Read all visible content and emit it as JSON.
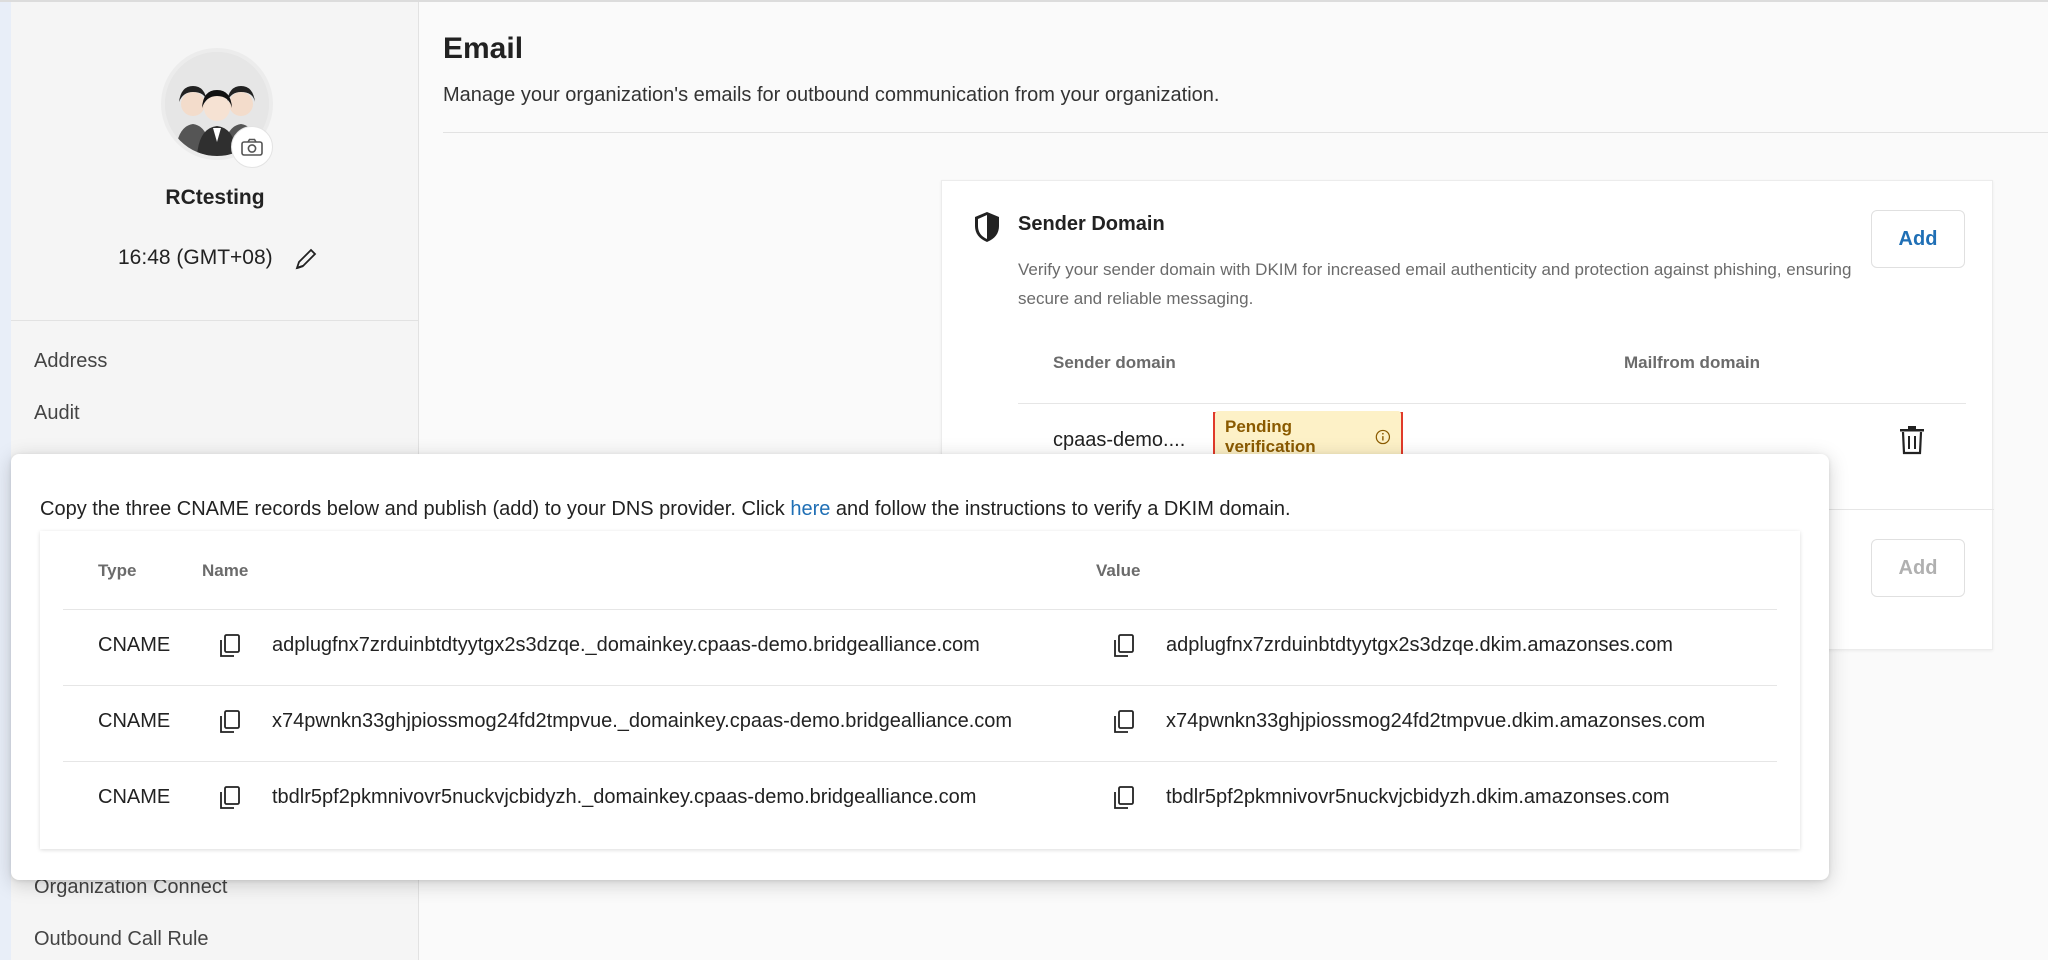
{
  "sidebar": {
    "org_name": "RCtesting",
    "time": "16:48 (GMT+08)",
    "items_top": [
      "Address",
      "Audit"
    ],
    "items_bottom": [
      "Organization Connect",
      "Outbound Call Rule"
    ]
  },
  "main": {
    "title": "Email",
    "subtitle": "Manage your organization's emails for outbound communication from your organization."
  },
  "card": {
    "title": "Sender Domain",
    "description": "Verify your sender domain with DKIM for increased email authenticity and protection against phishing, ensuring secure and reliable messaging.",
    "add_label": "Add",
    "add_disabled_label": "Add",
    "columns": [
      "Sender domain",
      "Mailfrom domain"
    ],
    "row": {
      "domain": "cpaas-demo....",
      "status": "Pending verification"
    }
  },
  "popover": {
    "instruction_before": "Copy the three CNAME records below and publish (add) to your DNS provider. Click ",
    "link_text": "here",
    "instruction_after": " and follow the instructions to verify a DKIM domain.",
    "headers": [
      "Type",
      "Name",
      "Value"
    ],
    "rows": [
      {
        "type": "CNAME",
        "name": "adplugfnx7zrduinbtdtyytgx2s3dzqe._domainkey.cpaas-demo.bridgealliance.com",
        "value": "adplugfnx7zrduinbtdtyytgx2s3dzqe.dkim.amazonses.com"
      },
      {
        "type": "CNAME",
        "name": "x74pwnkn33ghjpiossmog24fd2tmpvue._domainkey.cpaas-demo.bridgealliance.com",
        "value": "x74pwnkn33ghjpiossmog24fd2tmpvue.dkim.amazonses.com"
      },
      {
        "type": "CNAME",
        "name": "tbdlr5pf2pkmnivovr5nuckvjcbidyzh._domainkey.cpaas-demo.bridgealliance.com",
        "value": "tbdlr5pf2pkmnivovr5nuckvjcbidyzh.dkim.amazonses.com"
      }
    ]
  },
  "colors": {
    "link": "#1f6fb5",
    "badge_bg": "#fdf1c7",
    "badge_text": "#8a5a00",
    "highlight_border": "#e03a2a"
  }
}
